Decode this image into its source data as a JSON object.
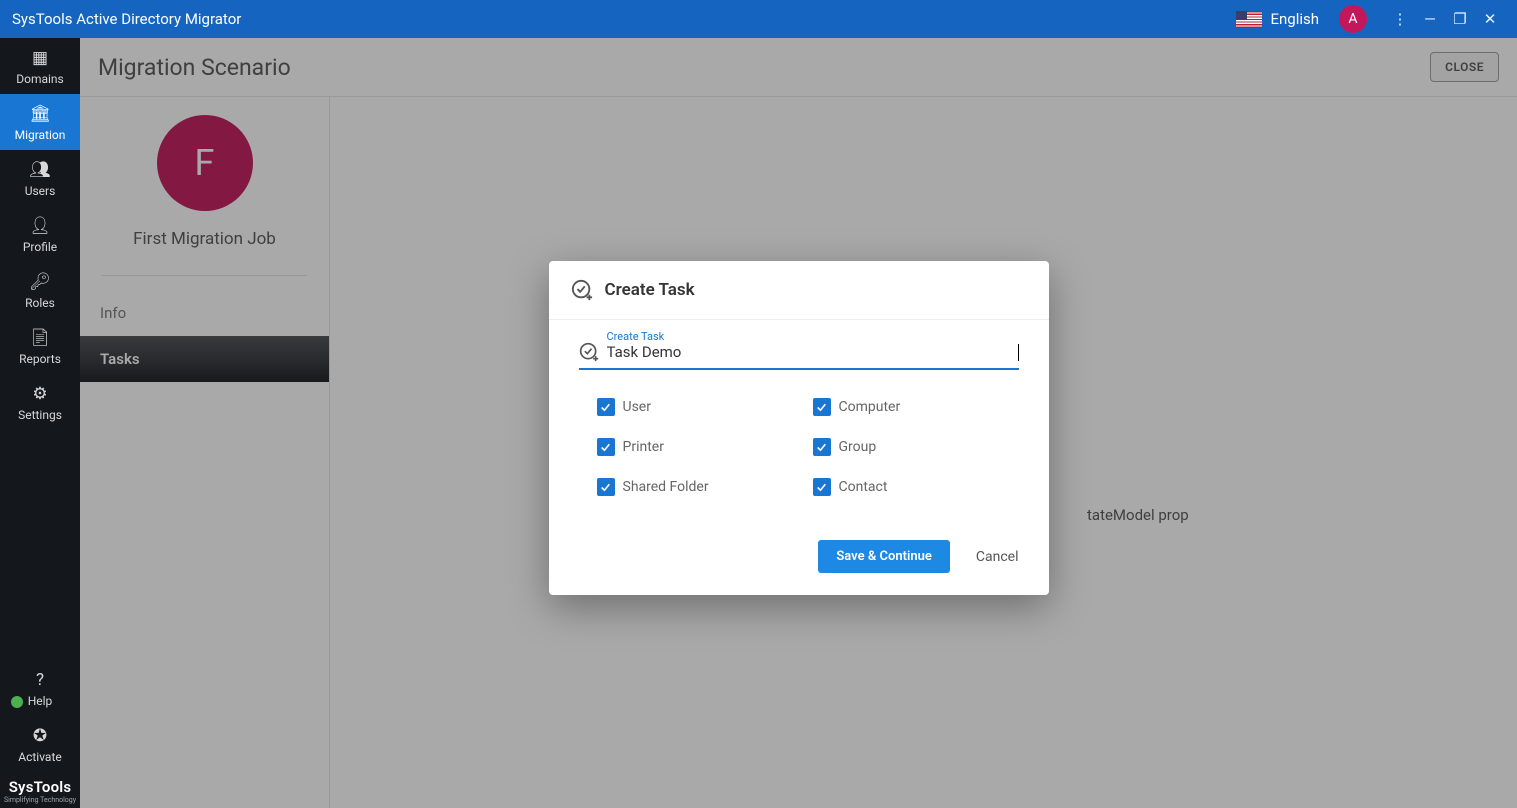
{
  "titlebar": {
    "app_title": "SysTools Active Directory Migrator",
    "language": "English",
    "avatar_letter": "A"
  },
  "sidebar": {
    "items": [
      {
        "label": "Domains"
      },
      {
        "label": "Migration"
      },
      {
        "label": "Users"
      },
      {
        "label": "Profile"
      },
      {
        "label": "Roles"
      },
      {
        "label": "Reports"
      },
      {
        "label": "Settings"
      }
    ],
    "footer": [
      {
        "label": "Help"
      },
      {
        "label": "Activate"
      }
    ],
    "brand": "SysTools",
    "brand_sub": "Simplifying Technology"
  },
  "page": {
    "title": "Migration Scenario",
    "close": "CLOSE"
  },
  "job": {
    "initial": "F",
    "name": "First Migration Job",
    "tabs": {
      "info": "Info",
      "tasks": "Tasks"
    }
  },
  "bg_fragment": "tateModel prop",
  "modal": {
    "title": "Create Task",
    "field_label": "Create Task",
    "input_value": "Task Demo",
    "options": {
      "user": "User",
      "computer": "Computer",
      "printer": "Printer",
      "group": "Group",
      "shared_folder": "Shared Folder",
      "contact": "Contact"
    },
    "save": "Save & Continue",
    "cancel": "Cancel"
  }
}
